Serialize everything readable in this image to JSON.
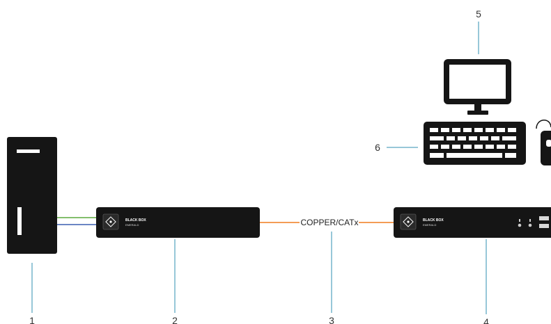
{
  "callouts": {
    "computer": "1",
    "transmitter": "2",
    "link": "3",
    "receiver": "4",
    "monitor": "5",
    "keyboard": "6"
  },
  "link_label": "COPPER/CATx",
  "transmitter": {
    "brand": "BLACK BOX",
    "model": "EMERALD"
  },
  "receiver": {
    "brand": "BLACK BOX",
    "model": "EMERALD"
  },
  "colors": {
    "device": "#151515",
    "callout_line": "#2f8fb0",
    "copper_line": "#f07c1e",
    "green_cable": "#5aaa3c",
    "blue_cable": "#3a5fb0"
  }
}
